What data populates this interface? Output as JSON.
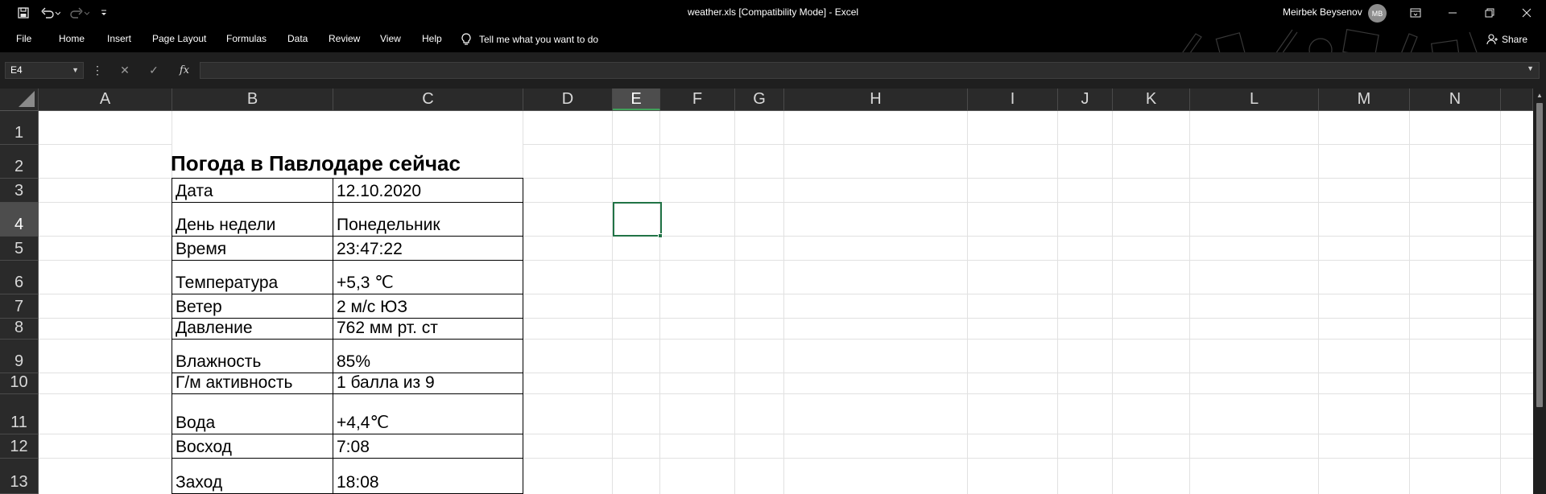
{
  "window": {
    "title": "weather.xls  [Compatibility Mode]  -  Excel",
    "user_name": "Meirbek Beysenov",
    "user_initials": "MB",
    "quick_access": {
      "save_icon": "save-icon",
      "undo_icon": "undo-icon",
      "redo_icon": "redo-icon",
      "customize_icon": "customize-qat-icon"
    }
  },
  "ribbon": {
    "tabs": [
      "File",
      "Home",
      "Insert",
      "Page Layout",
      "Formulas",
      "Data",
      "Review",
      "View",
      "Help"
    ],
    "tell_me": "Tell me what you want to do",
    "share": "Share"
  },
  "formula_bar": {
    "name_box": "E4",
    "fx_label": "fx",
    "formula": ""
  },
  "sheet": {
    "columns": [
      "A",
      "B",
      "C",
      "D",
      "E",
      "F",
      "G",
      "H",
      "I",
      "J",
      "K",
      "L",
      "M",
      "N"
    ],
    "rows": [
      "1",
      "2",
      "3",
      "4",
      "5",
      "6",
      "7",
      "8",
      "9",
      "10",
      "11",
      "12",
      "13"
    ],
    "selected_cell": "E4",
    "title": "Погода в Павлодаре сейчас",
    "table": [
      {
        "label": "Дата",
        "value": "12.10.2020"
      },
      {
        "label": "День недели",
        "value": "Понедельник"
      },
      {
        "label": "Время",
        "value": "23:47:22"
      },
      {
        "label": "Температура",
        "value": "+5,3 ℃"
      },
      {
        "label": "Ветер",
        "value": "2 м/с ЮЗ"
      },
      {
        "label": "Давление",
        "value": "762 мм рт. ст"
      },
      {
        "label": "Влажность",
        "value": "85%"
      },
      {
        "label": "Г/м активность",
        "value": "1 балла из 9"
      },
      {
        "label": "Вода",
        "value": "+4,4℃"
      },
      {
        "label": "Восход",
        "value": "7:08"
      },
      {
        "label": "Заход",
        "value": "18:08"
      }
    ]
  },
  "colors": {
    "title_bar": "#000000",
    "formula_bar": "#1f1f1f",
    "headers": "#2a2a2a",
    "selection": "#217346"
  }
}
